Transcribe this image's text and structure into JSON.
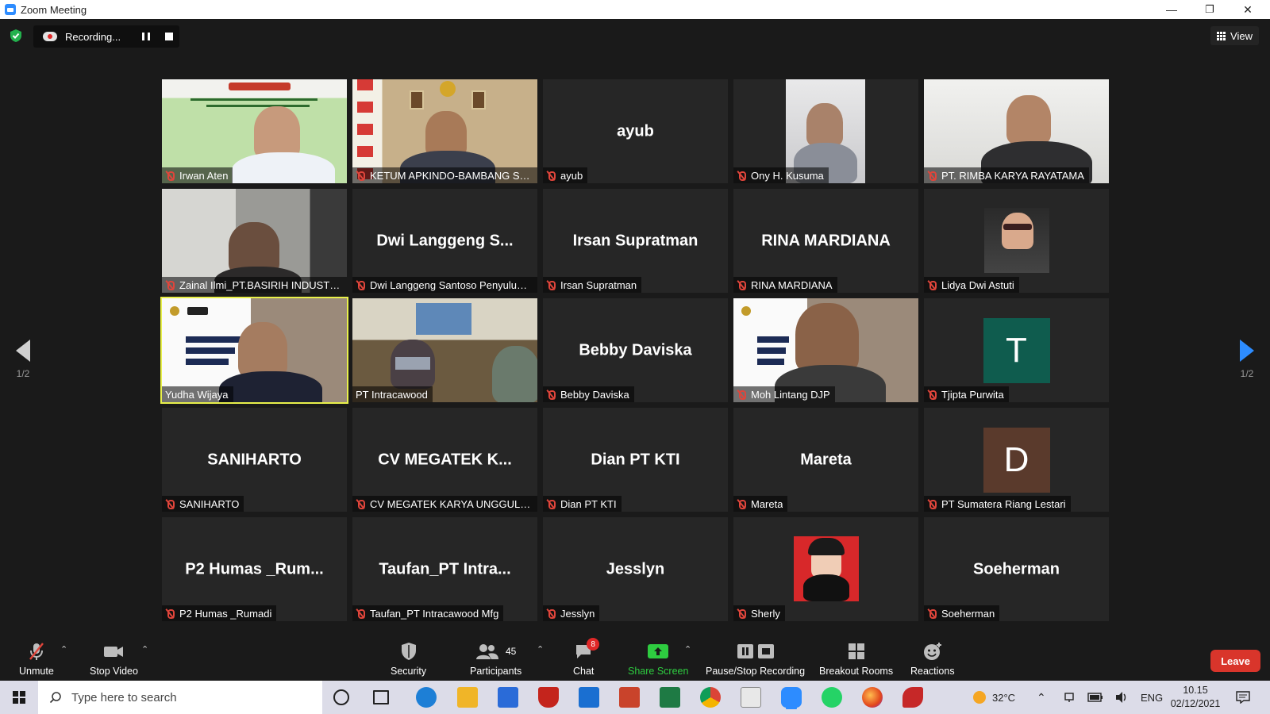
{
  "window": {
    "title": "Zoom Meeting",
    "minimize": "—",
    "restore": "❐",
    "close": "✕"
  },
  "recording": {
    "label": "Recording..."
  },
  "view": {
    "label": "View"
  },
  "tiles": [
    {
      "label": "Irwan Aten",
      "big": "",
      "video": "irwan"
    },
    {
      "label": "KETUM APKINDO-BAMBANG SOE...",
      "big": "",
      "video": "ketum"
    },
    {
      "label": "ayub",
      "big": "ayub",
      "video": ""
    },
    {
      "label": "Ony H. Kusuma",
      "big": "",
      "video": "ony"
    },
    {
      "label": "PT. RIMBA KARYA RAYATAMA",
      "big": "",
      "video": "rimba"
    },
    {
      "label": "Zainal Ilmi_PT.BASIRIH INDUSTRIAL",
      "big": "",
      "video": "zainal"
    },
    {
      "label": "Dwi Langgeng Santoso Penyuluh ...",
      "big": "Dwi Langgeng S...",
      "video": ""
    },
    {
      "label": "Irsan Supratman",
      "big": "Irsan Supratman",
      "video": ""
    },
    {
      "label": "RINA MARDIANA",
      "big": "RINA MARDIANA",
      "video": ""
    },
    {
      "label": "Lidya Dwi Astuti",
      "big": "",
      "video": "lidya"
    },
    {
      "label": "Yudha Wijaya",
      "big": "",
      "video": "yudha",
      "active": true,
      "unmuted": true
    },
    {
      "label": "PT Intracawood",
      "big": "",
      "video": "intraca",
      "unmuted": true
    },
    {
      "label": "Bebby Daviska",
      "big": "Bebby Daviska",
      "video": ""
    },
    {
      "label": "Moh Lintang DJP",
      "big": "",
      "video": "lintang"
    },
    {
      "label": "Tjipta Purwita",
      "big": "",
      "video": "",
      "avatar": "T",
      "avatar_color": "#0f5c4e"
    },
    {
      "label": "SANIHARTO",
      "big": "SANIHARTO",
      "video": ""
    },
    {
      "label": "CV MEGATEK KARYA UNGGUL_sul...",
      "big": "CV  MEGATEK  K...",
      "video": ""
    },
    {
      "label": "Dian PT KTI",
      "big": "Dian PT KTI",
      "video": ""
    },
    {
      "label": "Mareta",
      "big": "Mareta",
      "video": ""
    },
    {
      "label": "PT Sumatera Riang Lestari",
      "big": "",
      "video": "",
      "avatar": "D",
      "avatar_color": "#5a3a2c"
    },
    {
      "label": "P2 Humas _Rumadi",
      "big": "P2  Humas  _Rum...",
      "video": ""
    },
    {
      "label": "Taufan_PT Intracawood Mfg",
      "big": "Taufan_PT  Intra...",
      "video": ""
    },
    {
      "label": "Jesslyn",
      "big": "Jesslyn",
      "video": ""
    },
    {
      "label": "Sherly",
      "big": "",
      "video": "sherly"
    },
    {
      "label": "Soeherman",
      "big": "Soeherman",
      "video": ""
    }
  ],
  "pager": {
    "left": "1/2",
    "right": "1/2"
  },
  "toolbar": {
    "unmute": "Unmute",
    "stop_video": "Stop Video",
    "security": "Security",
    "participants": "Participants",
    "participants_count": "45",
    "chat": "Chat",
    "chat_badge": "8",
    "share_screen": "Share Screen",
    "pause_stop": "Pause/Stop Recording",
    "breakout": "Breakout Rooms",
    "reactions": "Reactions",
    "leave": "Leave"
  },
  "taskbar": {
    "search_placeholder": "Type here to search",
    "weather": "32°C",
    "lang": "ENG",
    "time": "10.15",
    "date": "02/12/2021"
  },
  "colors": {
    "accent": "#2d8cff",
    "active_speaker": "#e8f04a",
    "leave": "#d9352b",
    "share": "#2ecc40",
    "mute": "#e0453b"
  }
}
